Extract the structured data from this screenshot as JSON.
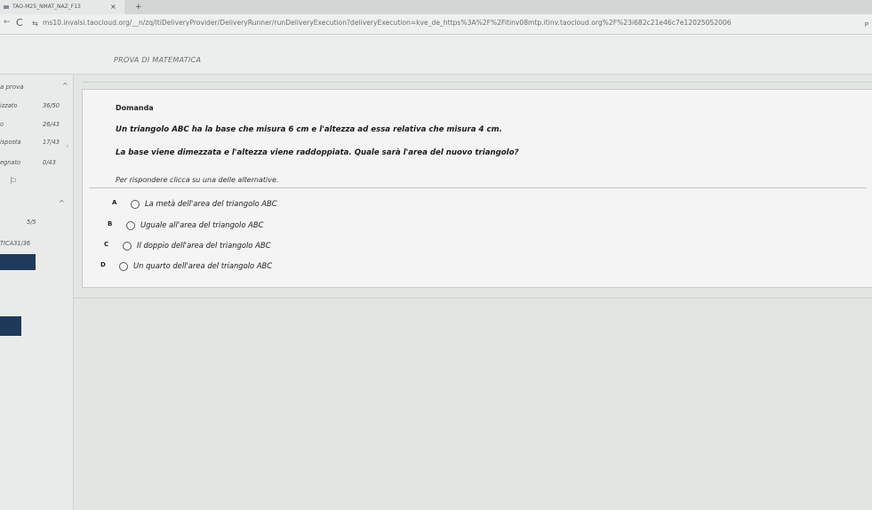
{
  "browser": {
    "tab_title": "TAO-M25_NMAT_NAZ_F13",
    "tab_close": "×",
    "tab_new": "+",
    "back_glyph": "←",
    "reload_glyph": "C",
    "site_glyph": "⇆",
    "url": "ms10.invalsi.taocloud.org/__n/zq/ltiDeliveryProvider/DeliveryRunner/runDeliveryExecution?deliveryExecution=kve_de_https%3A%2F%2Fitinv08mtp.itinv.taocloud.org%2F%23i682c21e46c7e12025052006",
    "profile": "P"
  },
  "app": {
    "title": "PROVA DI MATEMATICA"
  },
  "sidebar": {
    "header": "a prova",
    "caret": "^",
    "rows": [
      {
        "label": "izzato",
        "value": "36/50"
      },
      {
        "label": "o",
        "value": "26/43"
      },
      {
        "label": "isposta",
        "value": "17/43"
      },
      {
        "label": "egnato",
        "value": "0/43"
      }
    ],
    "arrow": "‹",
    "flag": "⚐",
    "section_caret": "^",
    "section_score": "5/5",
    "section_label": "TICA31/36"
  },
  "question": {
    "heading": "Domanda",
    "text1": "Un triangolo ABC ha la base che misura 6 cm e l'altezza ad essa relativa che misura 4 cm.",
    "text2": "La base viene dimezzata e l'altezza viene raddoppiata. Quale sarà l'area del nuovo triangolo?",
    "instruction": "Per rispondere clicca su una delle alternative.",
    "options": [
      {
        "letter": "A",
        "label": "La metà dell'area del triangolo ABC"
      },
      {
        "letter": "B",
        "label": "Uguale all'area del triangolo ABC"
      },
      {
        "letter": "C",
        "label": "Il doppio dell'area del triangolo ABC"
      },
      {
        "letter": "D",
        "label": "Un quarto dell'area del triangolo ABC"
      }
    ]
  }
}
